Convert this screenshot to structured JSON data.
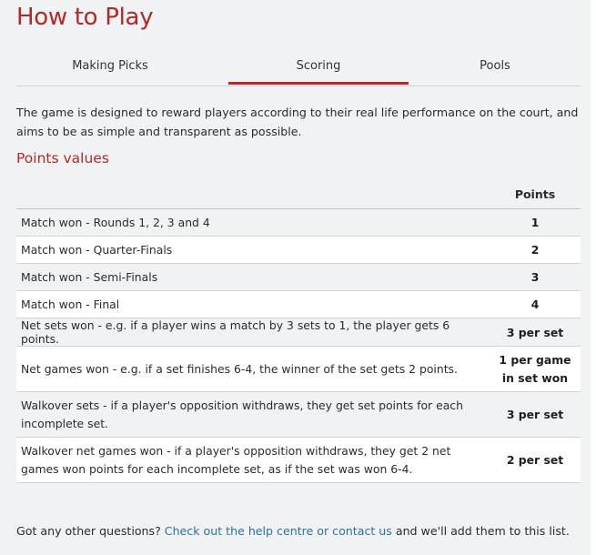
{
  "title": "How to Play",
  "tabs": [
    {
      "label": "Making Picks",
      "active": false
    },
    {
      "label": "Scoring",
      "active": true
    },
    {
      "label": "Pools",
      "active": false
    }
  ],
  "intro": "The game is designed to reward players according to their real life performance on the court, and aims to be as simple and transparent as possible.",
  "section_title": "Points values",
  "table": {
    "header_points": "Points",
    "rows": [
      {
        "description": "Match won - Rounds 1, 2, 3 and 4",
        "points": "1"
      },
      {
        "description": "Match won - Quarter-Finals",
        "points": "2"
      },
      {
        "description": "Match won - Semi-Finals",
        "points": "3"
      },
      {
        "description": "Match won - Final",
        "points": "4"
      },
      {
        "description": "Net sets won - e.g. if a player wins a match by 3 sets to 1, the player gets 6 points.",
        "points": "3 per set"
      },
      {
        "description": "Net games won - e.g. if a set finishes 6-4, the winner of the set gets 2 points.",
        "points": "1 per game in set won"
      },
      {
        "description": "Walkover sets - if a player's opposition withdraws, they get set points for each incomplete set.",
        "points": "3 per set"
      },
      {
        "description": "Walkover net games won - if a player's opposition withdraws, they get 2 net games won points for each incomplete set, as if the set was won 6-4.",
        "points": "2 per set"
      }
    ]
  },
  "footer": {
    "prefix": "Got any other questions? ",
    "link": "Check out the help centre or contact us",
    "suffix": " and we'll add them to this list."
  },
  "colors": {
    "accent": "#b02a2a",
    "link": "#2e6ea6",
    "background": "#f1f2f3"
  }
}
